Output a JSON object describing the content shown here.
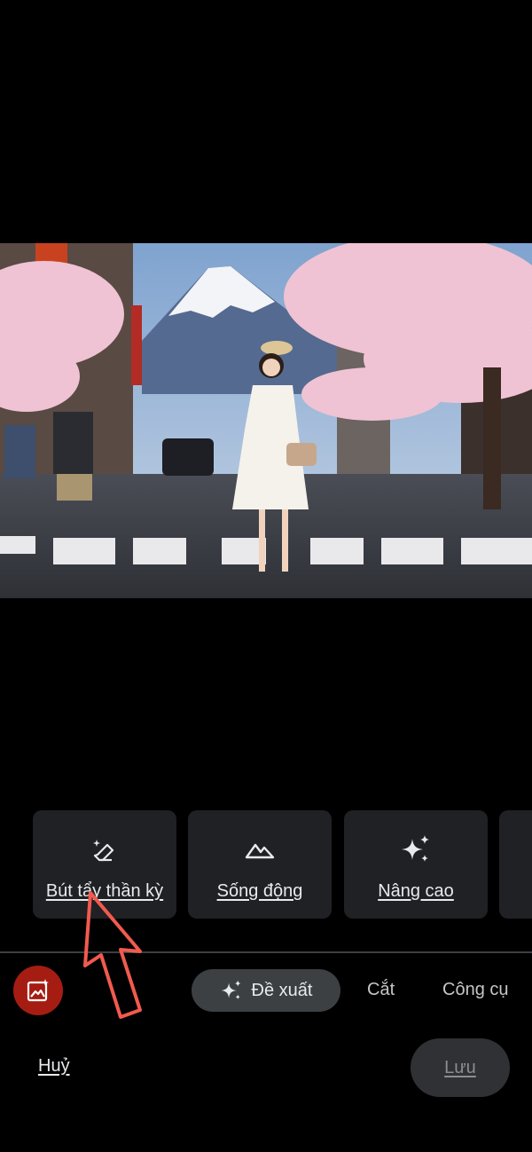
{
  "tools": [
    {
      "label": "Bút tẩy thần kỳ",
      "icon": "magic-eraser-icon"
    },
    {
      "label": "Sống động",
      "icon": "mountain-icon"
    },
    {
      "label": "Nâng cao",
      "icon": "sparkle-icon"
    }
  ],
  "bottom_nav": {
    "suggest_label": "Đề xuất",
    "crop_label": "Cắt",
    "tools_label": "Công cụ"
  },
  "actions": {
    "cancel_label": "Huỷ",
    "save_label": "Lưu"
  },
  "colors": {
    "card_bg": "#202124",
    "gallery_button": "#a51d12",
    "annotation_arrow": "#f25a4f"
  }
}
